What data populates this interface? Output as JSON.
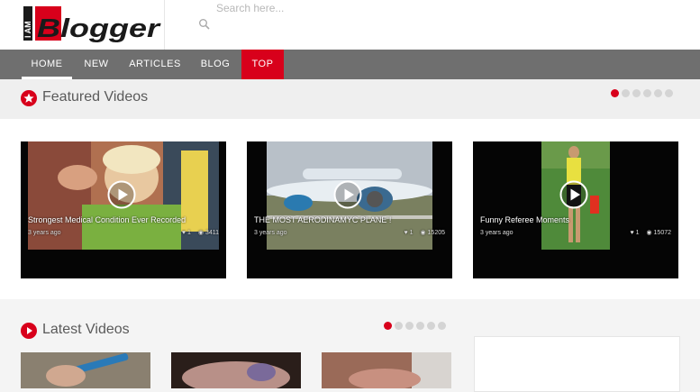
{
  "header": {
    "logo_small": "I AM",
    "logo_text": "Blogger",
    "search_placeholder": "Search here..."
  },
  "nav": [
    "HOME",
    "NEW",
    "ARTICLES",
    "BLOG",
    "TOP"
  ],
  "featured": {
    "title": "Featured Videos",
    "videos": [
      {
        "title": "Strongest Medical Condition Ever Recorded",
        "time": "3 years ago",
        "likes": "1",
        "views": "3411"
      },
      {
        "title": "THE MOST AERODINAMYC PLANE !",
        "time": "3 years ago",
        "likes": "1",
        "views": "15205"
      },
      {
        "title": "Funny Referee Moments",
        "time": "3 years ago",
        "likes": "1",
        "views": "15072"
      }
    ]
  },
  "latest": {
    "title": "Latest Videos"
  },
  "colors": {
    "accent": "#d8001b",
    "nav": "#6f6f6f"
  }
}
